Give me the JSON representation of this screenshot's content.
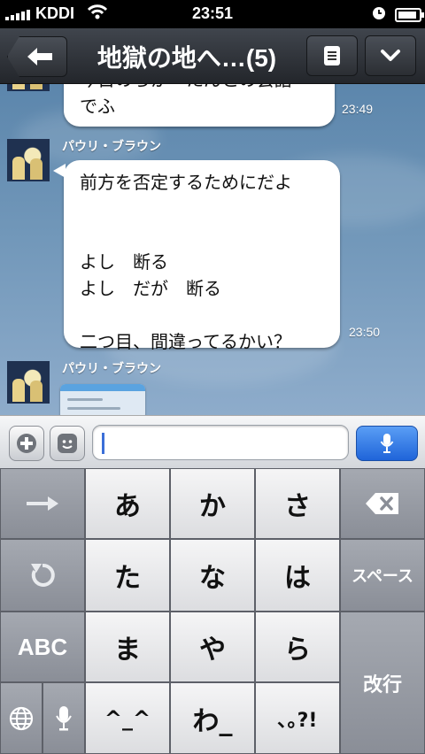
{
  "status": {
    "carrier": "KDDI",
    "time": "23:51"
  },
  "nav": {
    "title": "地獄の地へ…(5)"
  },
  "messages": [
    {
      "text": "今日のらかーたんとの会話\nでふ",
      "time": "23:49"
    },
    {
      "sender": "パウリ・ブラウン",
      "text": "前方を否定するためにだよ\n\n\nよし　断る\nよし　だが　断る\n\n二つ目、間違ってるかい？",
      "time": "23:50"
    },
    {
      "sender": "パウリ・ブラウン"
    }
  ],
  "input": {
    "value": ""
  },
  "keyboard": {
    "row1": [
      "あ",
      "か",
      "さ"
    ],
    "row2": [
      "た",
      "な",
      "は"
    ],
    "row3": [
      "ま",
      "や",
      "ら"
    ],
    "row4": [
      "^_^",
      "わ_",
      "､｡?!"
    ],
    "abc": "ABC",
    "space": "スペース",
    "return": "改行"
  }
}
